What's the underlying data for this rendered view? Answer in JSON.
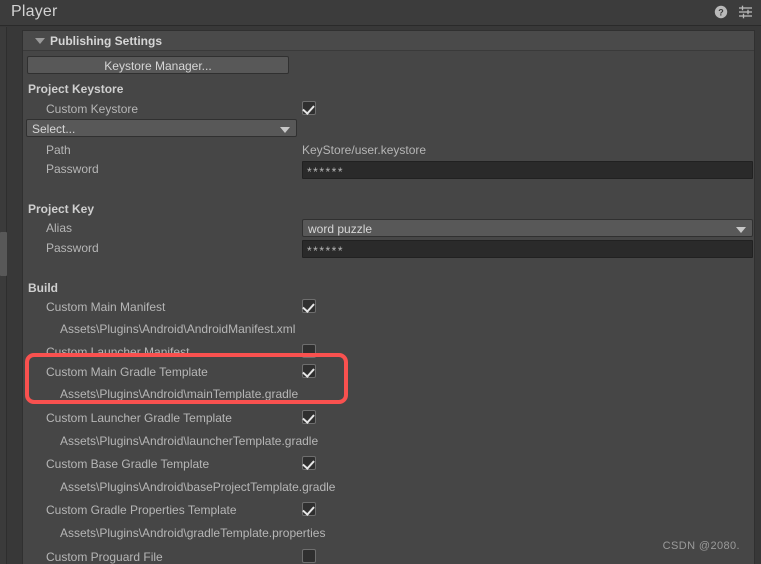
{
  "window": {
    "title": "Player",
    "help_icon": "help-circle-icon",
    "preset_icon": "preset-sliders-icon"
  },
  "foldout": {
    "label": "Publishing Settings",
    "expanded": true,
    "arrow_icon": "triangle-down-icon"
  },
  "keystore_manager_button": "Keystore Manager...",
  "sections": {
    "project_keystore": {
      "header": "Project Keystore",
      "custom_keystore_label": "Custom Keystore",
      "custom_keystore_checked": true,
      "select_dropdown_value": "Select...",
      "path_label": "Path",
      "path_value": "KeyStore/user.keystore",
      "password_label": "Password",
      "password_value": "******"
    },
    "project_key": {
      "header": "Project Key",
      "alias_label": "Alias",
      "alias_value": "word puzzle",
      "password_label": "Password",
      "password_value": "******"
    },
    "build": {
      "header": "Build",
      "items": [
        {
          "label": "Custom Main Manifest",
          "checked": true,
          "path": "Assets\\Plugins\\Android\\AndroidManifest.xml"
        },
        {
          "label": "Custom Launcher Manifest",
          "checked": false,
          "path": ""
        },
        {
          "label": "Custom Main Gradle Template",
          "checked": true,
          "path": "Assets\\Plugins\\Android\\mainTemplate.gradle"
        },
        {
          "label": "Custom Launcher Gradle Template",
          "checked": true,
          "path": "Assets\\Plugins\\Android\\launcherTemplate.gradle"
        },
        {
          "label": "Custom Base Gradle Template",
          "checked": true,
          "path": "Assets\\Plugins\\Android\\baseProjectTemplate.gradle"
        },
        {
          "label": "Custom Gradle Properties Template",
          "checked": true,
          "path": "Assets\\Plugins\\Android\\gradleTemplate.properties"
        },
        {
          "label": "Custom Proguard File",
          "checked": false,
          "path": ""
        }
      ]
    }
  },
  "annotation": {
    "highlight_color": "#f9514f",
    "highlights_item": "Custom Main Gradle Template"
  },
  "watermark": "CSDN @2080."
}
